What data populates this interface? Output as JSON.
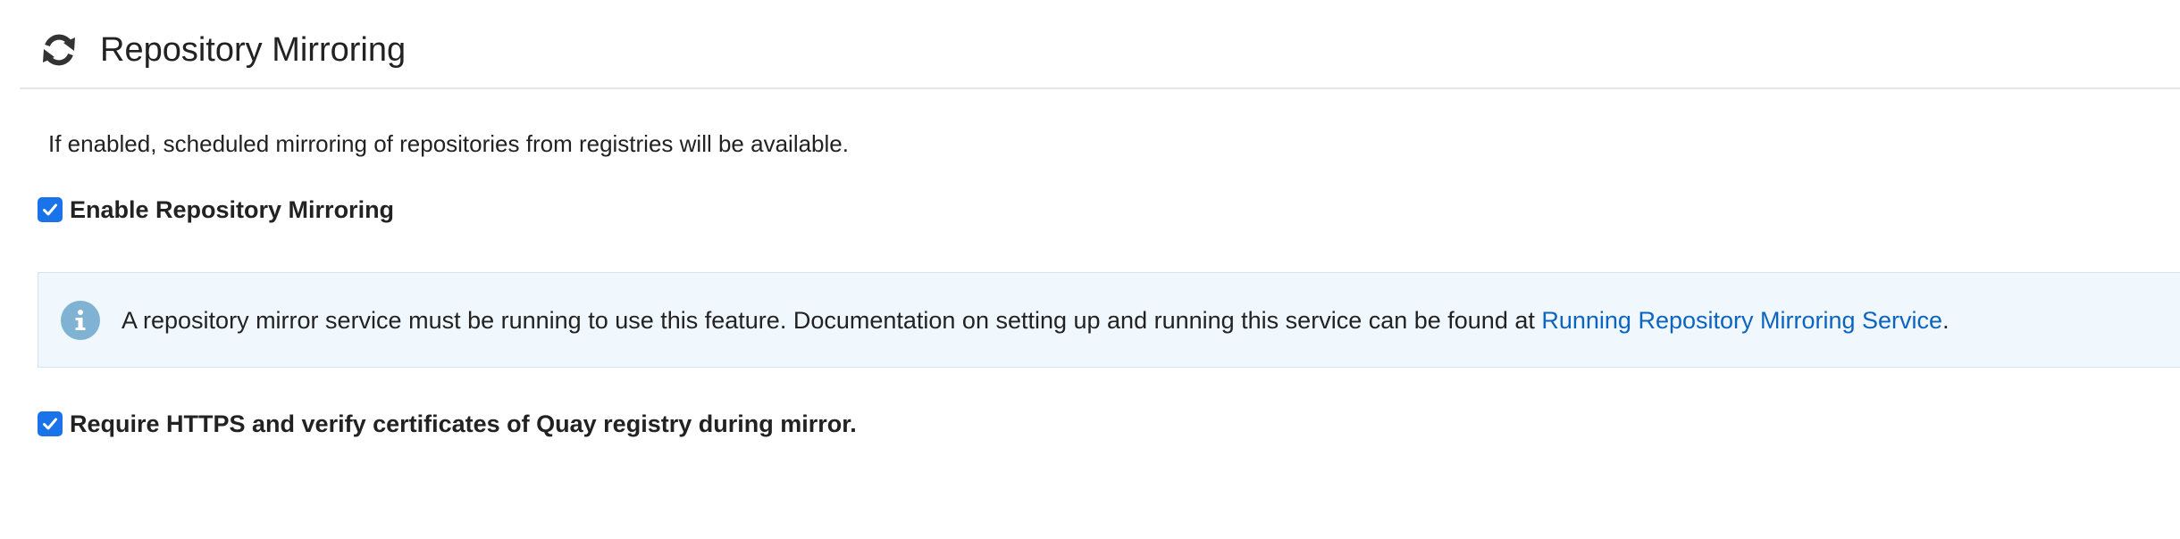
{
  "section": {
    "icon": "sync-icon",
    "title": "Repository Mirroring",
    "description": "If enabled, scheduled mirroring of repositories from registries will be available."
  },
  "enable_mirroring": {
    "label": "Enable Repository Mirroring",
    "checked": true
  },
  "info": {
    "icon": "info-circle-icon",
    "text": "A repository mirror service must be running to use this feature. Documentation on setting up and running this service can be found at ",
    "link_text": "Running Repository Mirroring Service",
    "suffix": "."
  },
  "require_https": {
    "label": "Require HTTPS and verify certificates of Quay registry during mirror.",
    "checked": true
  },
  "colors": {
    "checkbox": "#1a73e8",
    "link": "#0b64c0",
    "info_background": "#f0f8fd",
    "info_icon": "#7fb2d3",
    "text": "#222222"
  }
}
